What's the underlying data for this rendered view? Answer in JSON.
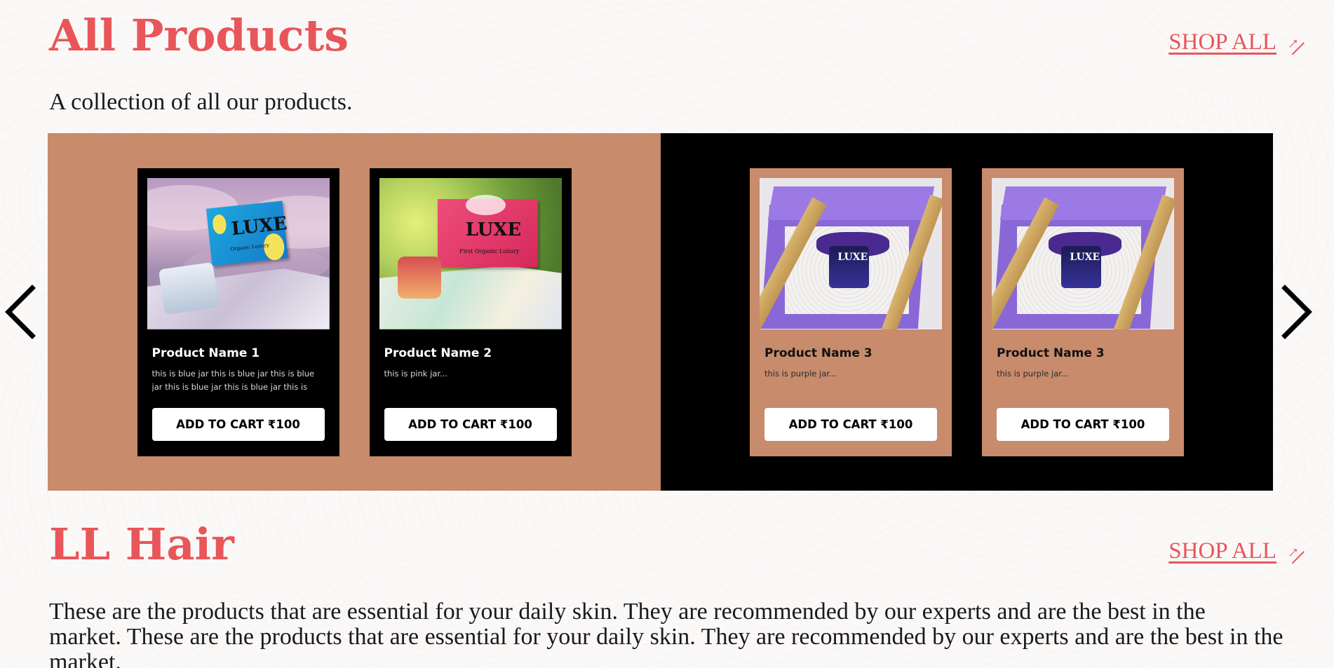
{
  "sections": {
    "all_products": {
      "title": "All Products",
      "description": "A collection of all our products.",
      "shop_all_label": "SHOP ALL",
      "shop_all_icon": "arrow-up-right-icon"
    },
    "ll_hair": {
      "title": "LL Hair",
      "description": "These are the products that are essential for your daily skin. They are recommended by our experts and are the best in the market. These are the products that are essential for your daily skin. They are recommended by our experts and are the best in the market.",
      "shop_all_label": "SHOP ALL",
      "shop_all_icon": "arrow-up-right-icon"
    }
  },
  "carousel": {
    "prev_icon": "chevron-left-icon",
    "next_icon": "chevron-right-icon",
    "panels": [
      {
        "background": "#c88b6c"
      },
      {
        "background": "#000000"
      }
    ],
    "products": [
      {
        "name": "Product Name 1",
        "description": "this is blue jar this is blue jar this is blue jar this is blue jar this is blue jar this is blue ja...",
        "button": "ADD TO CART ₹100",
        "image_logo": "LUXE",
        "image_caption": "Organic Luxury"
      },
      {
        "name": "Product Name 2",
        "description": "this is pink jar...",
        "button": "ADD TO CART ₹100",
        "image_logo": "LUXE",
        "image_caption": "First Organic Luxury"
      },
      {
        "name": "Product Name 3",
        "description": "this is purple jar...",
        "button": "ADD TO CART ₹100",
        "image_logo": "LUXE"
      },
      {
        "name": "Product Name 3",
        "description": "this is purple jar...",
        "button": "ADD TO CART ₹100",
        "image_logo": "LUXE"
      }
    ]
  },
  "colors": {
    "accent": "#e8565a",
    "tan": "#c88b6c",
    "black": "#000000",
    "page_bg": "#fbf9f8"
  }
}
